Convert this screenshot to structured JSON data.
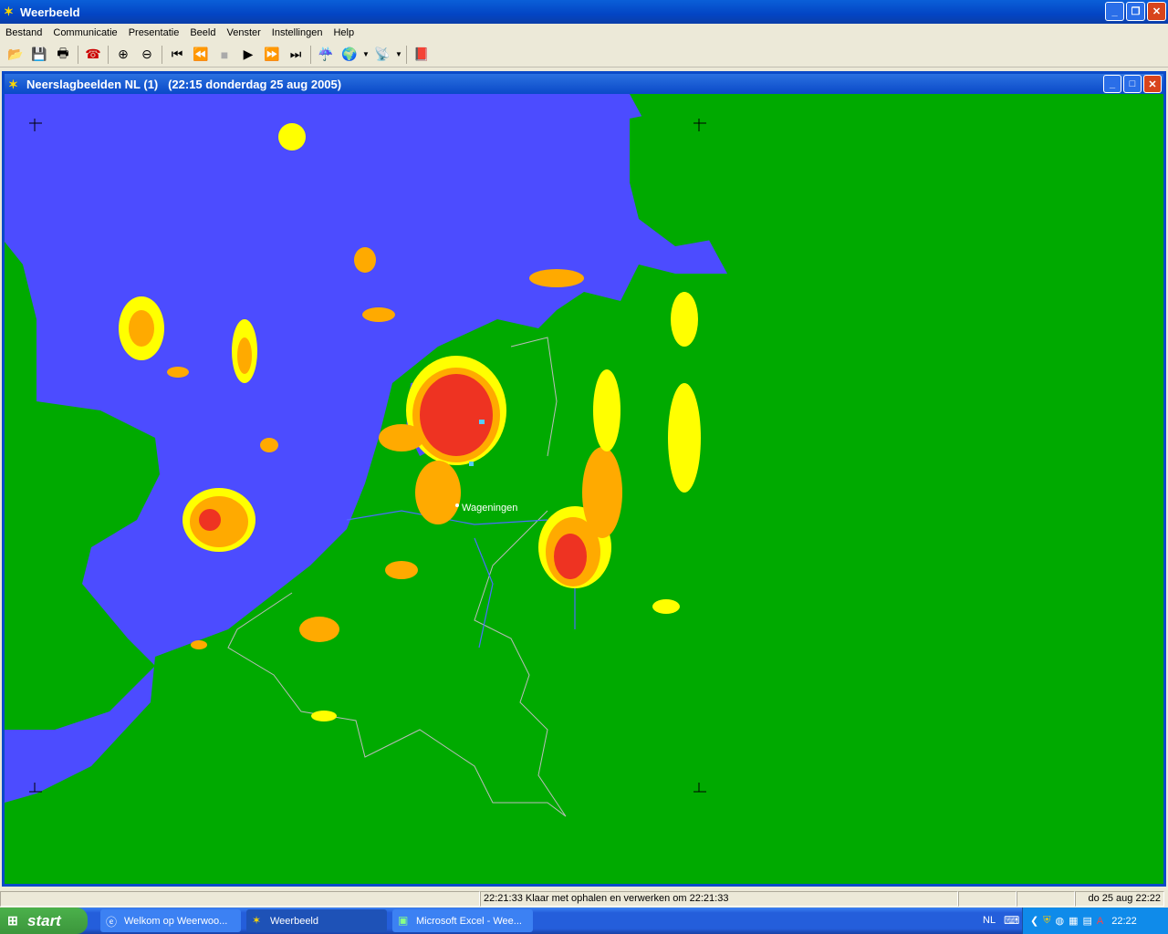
{
  "app": {
    "title": "Weerbeeld"
  },
  "menu": [
    "Bestand",
    "Communicatie",
    "Presentatie",
    "Beeld",
    "Venster",
    "Instellingen",
    "Help"
  ],
  "toolbar": {
    "icons": [
      "open-icon",
      "save-icon",
      "print-icon",
      "phone-icon",
      "zoom-in-icon",
      "zoom-out-icon",
      "first-frame-icon",
      "previous-frame-icon",
      "stop-icon",
      "play-icon",
      "next-frame-icon",
      "last-frame-icon",
      "weather-icon",
      "globe-icon",
      "satellite-icon",
      "book-icon"
    ]
  },
  "child": {
    "title": "Neerslagbeelden NL (1)   (22:15 donderdag 25 aug 2005)"
  },
  "map": {
    "city_label": "Wageningen",
    "colors": {
      "sea": "#4c4cff",
      "land": "#00aa00",
      "light": "#ffff00",
      "medium": "#ffaa00",
      "heavy": "#ee3322"
    }
  },
  "status": {
    "message": "22:21:33 Klaar met ophalen en verwerken om 22:21:33",
    "datetime": "do 25 aug 22:22"
  },
  "taskbar": {
    "start": "start",
    "tasks": [
      "Welkom op Weerwoo...",
      "Weerbeeld",
      "Microsoft Excel - Wee..."
    ],
    "language": "NL",
    "clock": "22:22"
  }
}
